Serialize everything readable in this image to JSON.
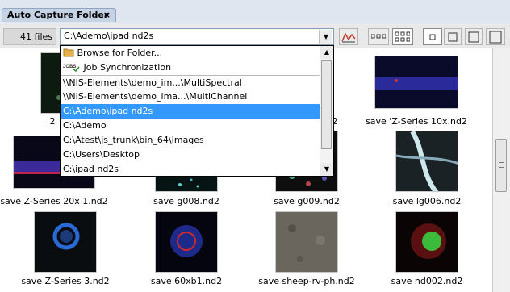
{
  "tab": {
    "title": "Auto Capture Folder",
    "close": "×"
  },
  "toolbar": {
    "file_count": "41 files",
    "path_value": "C:\\Ademo\\ipad nd2s",
    "dropdown_arrow": "▼",
    "buttons": [
      "chart",
      "list-3",
      "grid-6",
      "size-small",
      "size-medium",
      "size-large",
      "size-xlarge"
    ]
  },
  "dropdown": {
    "items": [
      {
        "label": "Browse for Folder...",
        "icon": "folder-icon"
      },
      {
        "label": "Job Synchronization",
        "icon": "jobs-icon"
      },
      {
        "label": "\\\\NIS-Elements\\demo_im...\\MultiSpectral"
      },
      {
        "label": "\\\\NIS-Elements\\demo_ima...\\MultiChannel"
      },
      {
        "label": "C:\\Ademo\\ipad nd2s",
        "selected": true
      },
      {
        "label": "C:\\Ademo"
      },
      {
        "label": "C:\\Atest\\js_trunk\\bin_64\\Images"
      },
      {
        "label": "C:\\Users\\Desktop"
      },
      {
        "label": "C:\\ipad nd2s"
      }
    ]
  },
  "thumbnails": [
    {
      "caption": "2",
      "style": "dark-cells"
    },
    {
      "caption": "2",
      "style": "hidden"
    },
    {
      "caption": "save 'Z-Series 10x.nd2",
      "style": "blue-band"
    },
    {
      "caption": "save Z-Series 20x 1.nd2",
      "style": "blue-red-band"
    },
    {
      "caption": "save g008.nd2",
      "style": "cyan-dots"
    },
    {
      "caption": "save g009.nd2",
      "style": "mixed-cells"
    },
    {
      "caption": "save lg006.nd2",
      "style": "white-fibers"
    },
    {
      "caption": "save Z-Series 3.nd2",
      "style": "blue-ring"
    },
    {
      "caption": "save 60xb1.nd2",
      "style": "red-ring"
    },
    {
      "caption": "save sheep-rv-ph.nd2",
      "style": "gray-tissue"
    },
    {
      "caption": "save nd002.nd2",
      "style": "green-red"
    }
  ]
}
